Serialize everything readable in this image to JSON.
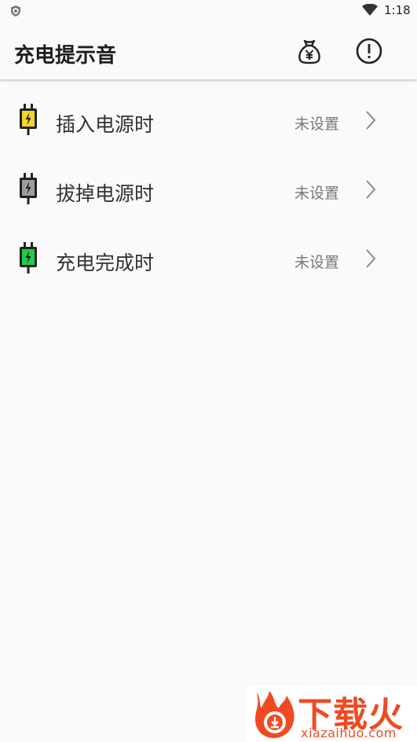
{
  "status_bar": {
    "time": "1:18",
    "shield_icon": "shield-icon",
    "wifi_icon": "wifi-icon"
  },
  "app_bar": {
    "title": "充电提示音",
    "money_bag_icon": "money-bag-yen-icon",
    "info_icon": "info-icon"
  },
  "items": [
    {
      "label": "插入电源时",
      "status": "未设置",
      "icon": "battery-plug-yellow-icon",
      "color": "#f5d623"
    },
    {
      "label": "拔掉电源时",
      "status": "未设置",
      "icon": "battery-plug-gray-icon",
      "color": "#9e9e9e"
    },
    {
      "label": "充电完成时",
      "status": "未设置",
      "icon": "battery-plug-green-icon",
      "color": "#22cc44"
    }
  ],
  "watermark": {
    "title": "下载火",
    "url": "xiazaihuo.com",
    "color": "#f04a22"
  }
}
